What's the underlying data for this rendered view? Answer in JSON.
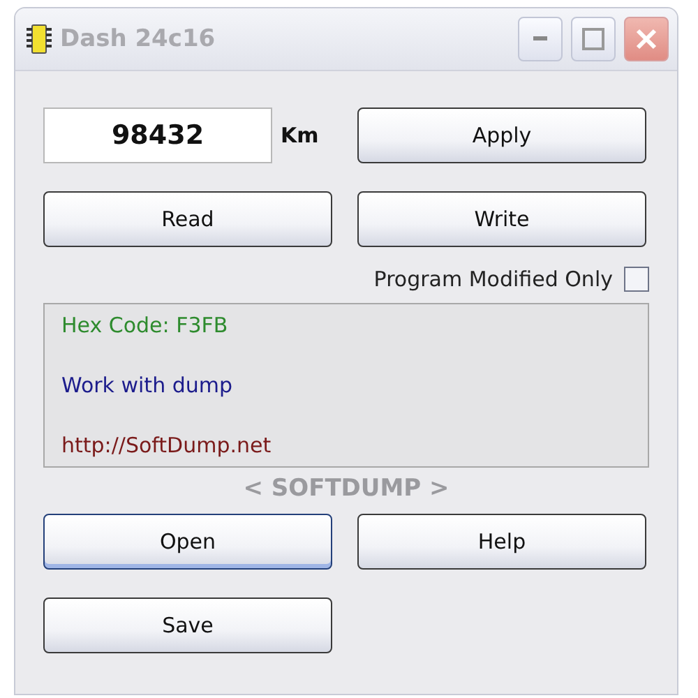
{
  "window": {
    "title": "Dash 24c16",
    "controls": [
      {
        "kind": "minimize"
      },
      {
        "kind": "maximize"
      },
      {
        "kind": "close"
      }
    ]
  },
  "odometer": {
    "value": "98432",
    "unit": "Km"
  },
  "buttons_top": [
    {
      "label": "Apply",
      "focused": false
    },
    {
      "label": "Read",
      "focused": false
    },
    {
      "label": "Write",
      "focused": false
    }
  ],
  "program_modified_only": {
    "label": "Program Modified Only",
    "checked": false
  },
  "messages": [
    {
      "text": "Hex Code: F3FB",
      "color": "#2e8b2e"
    },
    {
      "text": "Work with dump",
      "color": "#1c1c8c"
    },
    {
      "text": "http://SoftDump.net",
      "color": "#7a1a1a"
    }
  ],
  "brand": "< SOFTDUMP >",
  "buttons_bottom": [
    {
      "label": "Open",
      "focused": true
    },
    {
      "label": "Help",
      "focused": false
    },
    {
      "label": "Save",
      "focused": false
    }
  ]
}
